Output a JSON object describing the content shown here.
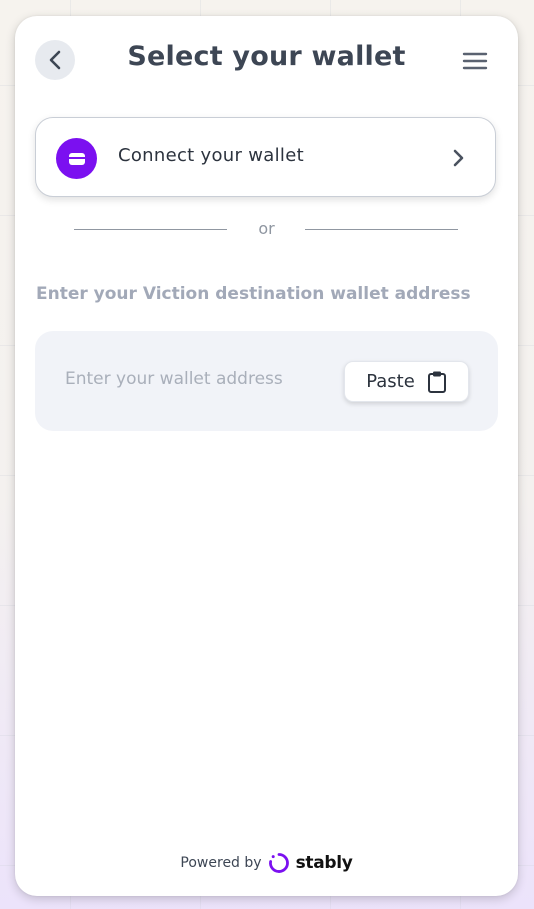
{
  "header": {
    "title": "Select your wallet",
    "back_icon": "chevron-left-icon",
    "menu_icon": "hamburger-menu-icon"
  },
  "connect": {
    "label": "Connect your wallet",
    "icon": "wallet-icon",
    "arrow_icon": "chevron-right-icon",
    "badge_color": "#7b10f0"
  },
  "divider": {
    "text": "or"
  },
  "destination": {
    "label": "Enter your Viction destination wallet address",
    "placeholder": "Enter your wallet address",
    "value": "",
    "paste_label": "Paste",
    "paste_icon": "clipboard-icon"
  },
  "footer": {
    "powered_by": "Powered by",
    "brand": "stably",
    "brand_color": "#7b10f0"
  }
}
